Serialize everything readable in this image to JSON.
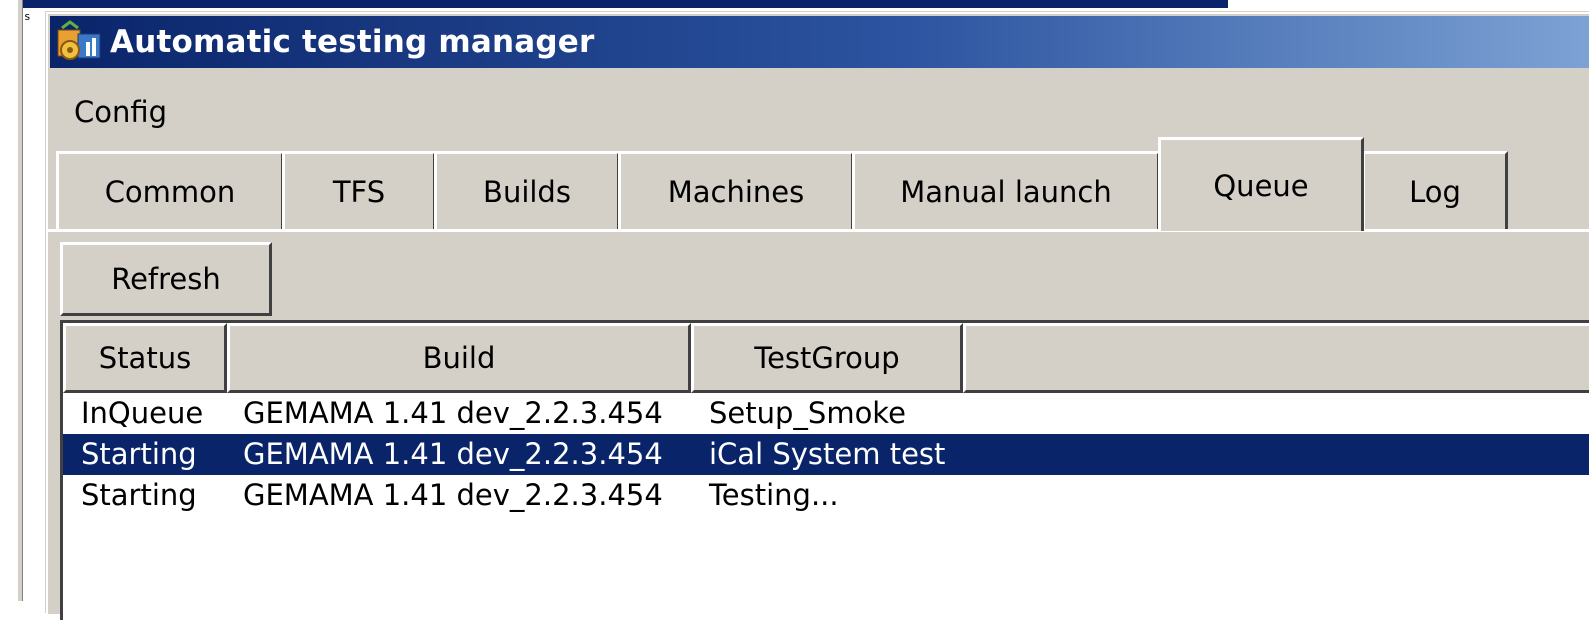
{
  "window": {
    "title": "Automatic testing manager",
    "titlebar_color": "#0a246a"
  },
  "background_window": {
    "fragment_char": "s"
  },
  "menu": {
    "items": [
      {
        "label": "Config"
      }
    ]
  },
  "tabs": [
    {
      "label": "Common",
      "active": false
    },
    {
      "label": "TFS",
      "active": false
    },
    {
      "label": "Builds",
      "active": false
    },
    {
      "label": "Machines",
      "active": false
    },
    {
      "label": "Manual launch",
      "active": false
    },
    {
      "label": "Queue",
      "active": true
    },
    {
      "label": "Log",
      "active": false
    }
  ],
  "queue_panel": {
    "refresh_label": "Refresh",
    "columns": [
      "Status",
      "Build",
      "TestGroup"
    ],
    "rows": [
      {
        "status": "InQueue",
        "build": "GEMAMA 1.41 dev_2.2.3.454",
        "test_group": "Setup_Smoke",
        "selected": false
      },
      {
        "status": "Starting",
        "build": "GEMAMA 1.41 dev_2.2.3.454",
        "test_group": "iCal System test",
        "selected": true
      },
      {
        "status": "Starting",
        "build": "GEMAMA 1.41 dev_2.2.3.454",
        "test_group": "Testing...",
        "selected": false
      }
    ],
    "selection_color": "#0a246a"
  }
}
